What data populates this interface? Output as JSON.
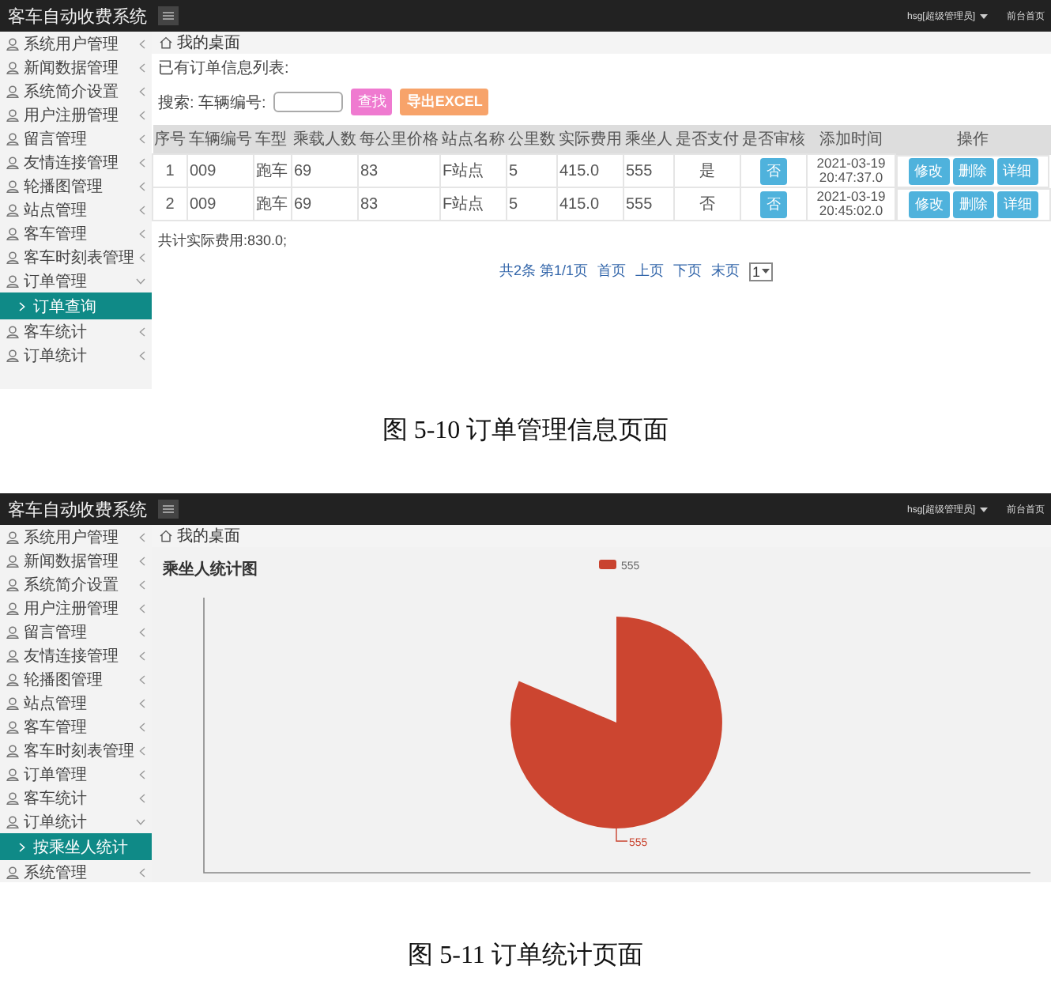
{
  "figures": [
    {
      "app_title": "客车自动收费系统",
      "user_menu": "hsg[超级管理员]",
      "front_link": "前台首页",
      "breadcrumb": "我的桌面",
      "sidebar": [
        {
          "label": "系统用户管理",
          "expanded": false
        },
        {
          "label": "新闻数据管理",
          "expanded": false
        },
        {
          "label": "系统简介设置",
          "expanded": false
        },
        {
          "label": "用户注册管理",
          "expanded": false
        },
        {
          "label": "留言管理",
          "expanded": false
        },
        {
          "label": "友情连接管理",
          "expanded": false
        },
        {
          "label": "轮播图管理",
          "expanded": false
        },
        {
          "label": "站点管理",
          "expanded": false
        },
        {
          "label": "客车管理",
          "expanded": false
        },
        {
          "label": "客车时刻表管理",
          "expanded": false
        },
        {
          "label": "订单管理",
          "expanded": true,
          "children": [
            {
              "label": "订单查询",
              "selected": true
            }
          ]
        },
        {
          "label": "客车统计",
          "expanded": false
        },
        {
          "label": "订单统计",
          "expanded": false
        }
      ],
      "content": {
        "kind": "order_table",
        "list_title": "已有订单信息列表:",
        "search_label": "搜索: 车辆编号:",
        "search_button": "查找",
        "export_button": "导出EXCEL",
        "columns": [
          "序号",
          "车辆编号",
          "车型",
          "乘载人数",
          "每公里价格",
          "站点名称",
          "公里数",
          "实际费用",
          "乘坐人",
          "是否支付",
          "是否审核",
          "添加时间",
          "操作"
        ],
        "rows": [
          {
            "cells": [
              "1",
              "009",
              "跑车",
              "69",
              "83",
              "F站点",
              "5",
              "415.0",
              "555",
              "是"
            ],
            "review": "否",
            "time": "2021-03-19 20:47:37.0",
            "actions": [
              "修改",
              "删除",
              "详细"
            ]
          },
          {
            "cells": [
              "2",
              "009",
              "跑车",
              "69",
              "83",
              "F站点",
              "5",
              "415.0",
              "555",
              "否"
            ],
            "review": "否",
            "time": "2021-03-19 20:45:02.0",
            "actions": [
              "修改",
              "删除",
              "详细"
            ]
          }
        ],
        "total": "共计实际费用:830.0;",
        "pagination": {
          "summary": "共2条 第1/1页",
          "links": [
            "首页",
            "上页",
            "下页",
            "末页"
          ],
          "page": "1"
        }
      },
      "caption": "图 5-10 订单管理信息页面"
    },
    {
      "app_title": "客车自动收费系统",
      "user_menu": "hsg[超级管理员]",
      "front_link": "前台首页",
      "breadcrumb": "我的桌面",
      "sidebar": [
        {
          "label": "系统用户管理",
          "expanded": false
        },
        {
          "label": "新闻数据管理",
          "expanded": false
        },
        {
          "label": "系统简介设置",
          "expanded": false
        },
        {
          "label": "用户注册管理",
          "expanded": false
        },
        {
          "label": "留言管理",
          "expanded": false
        },
        {
          "label": "友情连接管理",
          "expanded": false
        },
        {
          "label": "轮播图管理",
          "expanded": false
        },
        {
          "label": "站点管理",
          "expanded": false
        },
        {
          "label": "客车管理",
          "expanded": false
        },
        {
          "label": "客车时刻表管理",
          "expanded": false
        },
        {
          "label": "订单管理",
          "expanded": false
        },
        {
          "label": "客车统计",
          "expanded": false
        },
        {
          "label": "订单统计",
          "expanded": true,
          "children": [
            {
              "label": "按乘坐人统计",
              "selected": true
            }
          ]
        },
        {
          "label": "系统管理",
          "expanded": false
        }
      ],
      "content": {
        "kind": "pie_chart",
        "title": "乘坐人统计图",
        "legend": "555",
        "slice_label": "555"
      },
      "caption": "图 5-11 订单统计页面"
    }
  ]
}
